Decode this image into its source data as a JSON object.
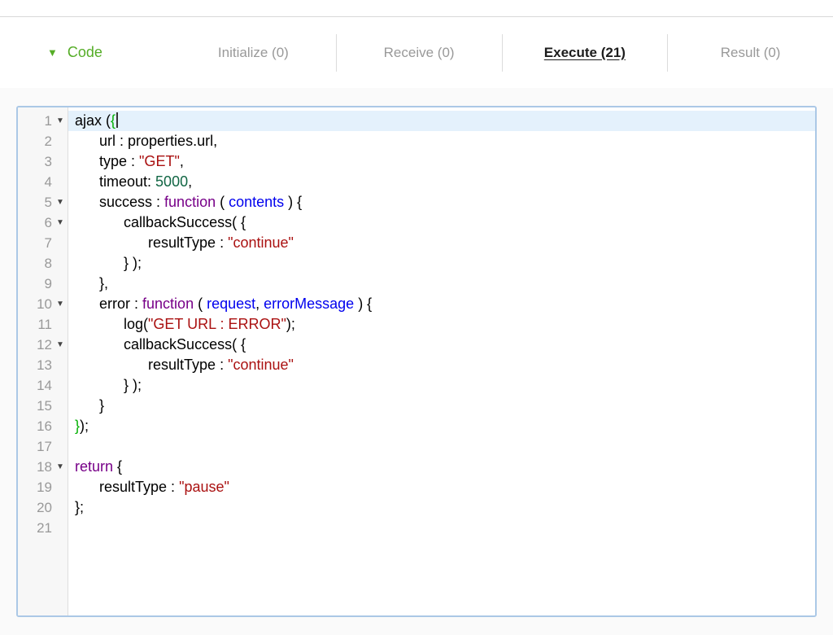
{
  "tabs": {
    "code": {
      "label": "Code",
      "icon": "▼"
    },
    "items": [
      {
        "label": "Initialize (0)",
        "active": false
      },
      {
        "label": "Receive (0)",
        "active": false
      },
      {
        "label": "Execute (21)",
        "active": true
      },
      {
        "label": "Result (0)",
        "active": false
      }
    ]
  },
  "colors": {
    "accent_green": "#55ad27",
    "tab_inactive": "#999999",
    "tab_active": "#1c1c1c",
    "code_plain": "#000000",
    "code_string": "#aa1111",
    "code_number": "#116644",
    "code_keyword": "#770088",
    "code_variable": "#0000ee",
    "code_bracket_match": "#00b000",
    "active_line_bg": "#e4f1fc",
    "editor_border": "#abc8e6",
    "gutter_bg": "#f7f7f7",
    "line_number": "#999999"
  },
  "editor": {
    "fold_icon": "▼",
    "lines": [
      {
        "num": 1,
        "fold": true,
        "active": true,
        "cursor": true,
        "tokens": [
          [
            "plain",
            "ajax ("
          ],
          [
            "match",
            "{"
          ]
        ]
      },
      {
        "num": 2,
        "fold": false,
        "tokens": [
          [
            "plain",
            "\turl : properties.url,"
          ]
        ]
      },
      {
        "num": 3,
        "fold": false,
        "tokens": [
          [
            "plain",
            "\ttype : "
          ],
          [
            "string",
            "\"GET\""
          ],
          [
            "plain",
            ","
          ]
        ]
      },
      {
        "num": 4,
        "fold": false,
        "tokens": [
          [
            "plain",
            "\ttimeout: "
          ],
          [
            "number",
            "5000"
          ],
          [
            "plain",
            ","
          ]
        ]
      },
      {
        "num": 5,
        "fold": true,
        "tokens": [
          [
            "plain",
            "\tsuccess : "
          ],
          [
            "keyword",
            "function"
          ],
          [
            "plain",
            " ( "
          ],
          [
            "variable",
            "contents"
          ],
          [
            "plain",
            " ) {"
          ]
        ]
      },
      {
        "num": 6,
        "fold": true,
        "tokens": [
          [
            "plain",
            "\t\tcallbackSuccess( {"
          ]
        ]
      },
      {
        "num": 7,
        "fold": false,
        "tokens": [
          [
            "plain",
            "\t\t\tresultType : "
          ],
          [
            "string",
            "\"continue\""
          ]
        ]
      },
      {
        "num": 8,
        "fold": false,
        "tokens": [
          [
            "plain",
            "\t\t} );"
          ]
        ]
      },
      {
        "num": 9,
        "fold": false,
        "tokens": [
          [
            "plain",
            "\t},"
          ]
        ]
      },
      {
        "num": 10,
        "fold": true,
        "tokens": [
          [
            "plain",
            "\terror : "
          ],
          [
            "keyword",
            "function"
          ],
          [
            "plain",
            " ( "
          ],
          [
            "variable",
            "request"
          ],
          [
            "plain",
            ", "
          ],
          [
            "variable",
            "errorMessage"
          ],
          [
            "plain",
            " ) {"
          ]
        ]
      },
      {
        "num": 11,
        "fold": false,
        "tokens": [
          [
            "plain",
            "\t\tlog("
          ],
          [
            "string",
            "\"GET URL : ERROR\""
          ],
          [
            "plain",
            ");"
          ]
        ]
      },
      {
        "num": 12,
        "fold": true,
        "tokens": [
          [
            "plain",
            "\t\tcallbackSuccess( {"
          ]
        ]
      },
      {
        "num": 13,
        "fold": false,
        "tokens": [
          [
            "plain",
            "\t\t\tresultType : "
          ],
          [
            "string",
            "\"continue\""
          ]
        ]
      },
      {
        "num": 14,
        "fold": false,
        "tokens": [
          [
            "plain",
            "\t\t} );"
          ]
        ]
      },
      {
        "num": 15,
        "fold": false,
        "tokens": [
          [
            "plain",
            "\t}"
          ]
        ]
      },
      {
        "num": 16,
        "fold": false,
        "tokens": [
          [
            "match",
            "}"
          ],
          [
            "plain",
            ");"
          ]
        ]
      },
      {
        "num": 17,
        "fold": false,
        "tokens": []
      },
      {
        "num": 18,
        "fold": true,
        "tokens": [
          [
            "keyword",
            "return"
          ],
          [
            "plain",
            " {"
          ]
        ]
      },
      {
        "num": 19,
        "fold": false,
        "tokens": [
          [
            "plain",
            "\tresultType : "
          ],
          [
            "string",
            "\"pause\""
          ]
        ]
      },
      {
        "num": 20,
        "fold": false,
        "tokens": [
          [
            "plain",
            "};"
          ]
        ]
      },
      {
        "num": 21,
        "fold": false,
        "tokens": []
      }
    ]
  }
}
